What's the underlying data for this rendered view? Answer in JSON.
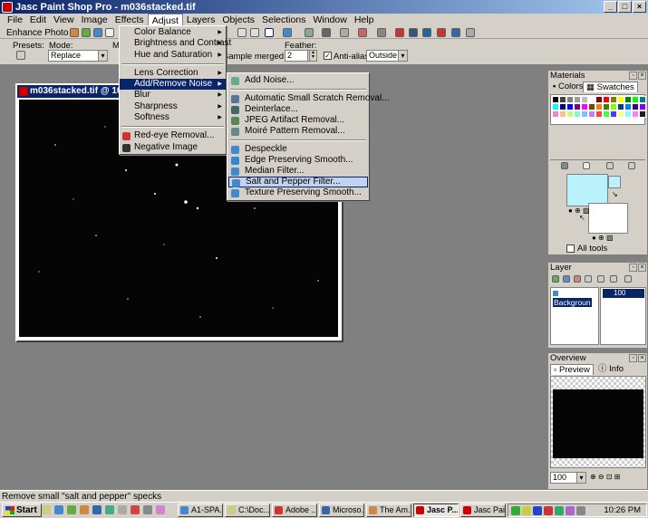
{
  "app": {
    "title": "Jasc Paint Shop Pro - m036stacked.tif"
  },
  "window_buttons": [
    "_",
    "□",
    "×"
  ],
  "menubar": [
    "File",
    "Edit",
    "View",
    "Image",
    "Effects",
    "Adjust",
    "Layers",
    "Objects",
    "Selections",
    "Window",
    "Help"
  ],
  "toolbar": {
    "enhance_photo": "Enhance Photo"
  },
  "options": {
    "presets_label": "Presets:",
    "mode_label": "Mode:",
    "mode_value": "Replace",
    "sample_label": "Sample merged",
    "feather_label": "Feather:",
    "feather_value": "2",
    "antialias_label": "Anti-alias",
    "antialias_value": "Outside",
    "match_partial": "M"
  },
  "image_window": {
    "title": "m036stacked.tif @ 100%"
  },
  "adjust_menu": {
    "items": [
      {
        "label": "Color Balance",
        "sub": true
      },
      {
        "label": "Brightness and Contrast",
        "sub": true
      },
      {
        "label": "Hue and Saturation",
        "sub": true
      },
      {
        "sep": true
      },
      {
        "label": "Lens Correction",
        "sub": true
      },
      {
        "label": "Add/Remove Noise",
        "sub": true,
        "hl": true
      },
      {
        "label": "Blur",
        "sub": true
      },
      {
        "label": "Sharpness",
        "sub": true
      },
      {
        "label": "Softness",
        "sub": true
      },
      {
        "sep": true
      },
      {
        "label": "Red-eye Removal...",
        "icon": "red-eye-icon"
      },
      {
        "label": "Negative Image",
        "icon": "negative-icon"
      }
    ]
  },
  "noise_menu": {
    "items": [
      {
        "label": "Add Noise...",
        "icon": "add-noise-icon"
      },
      {
        "sep": true
      },
      {
        "label": "Automatic Small Scratch Removal...",
        "icon": "scratch-icon"
      },
      {
        "label": "Deinterlace...",
        "icon": "deinterlace-icon"
      },
      {
        "label": "JPEG Artifact Removal...",
        "icon": "jpeg-icon"
      },
      {
        "label": "Moiré Pattern Removal...",
        "icon": "moire-icon"
      },
      {
        "sep": true
      },
      {
        "label": "Despeckle",
        "icon": "despeckle-icon"
      },
      {
        "label": "Edge Preserving Smooth...",
        "icon": "edge-smooth-icon"
      },
      {
        "label": "Median Filter...",
        "icon": "median-icon"
      },
      {
        "label": "Salt and Pepper Filter...",
        "icon": "salt-pepper-icon",
        "hl": true
      },
      {
        "label": "Texture Preserving Smooth...",
        "icon": "texture-smooth-icon"
      }
    ]
  },
  "materials": {
    "title": "Materials",
    "tab_colors": "Colors",
    "tab_swatches": "Swatches",
    "all_tools": "All tools"
  },
  "layers": {
    "title": "Layer",
    "layer_name": "Backgroun",
    "opacity_val": "100"
  },
  "overview": {
    "title": "Overview",
    "tab_preview": "Preview",
    "tab_info": "Info",
    "zoom": "100"
  },
  "status": "Remove small \"salt and pepper\" specks",
  "taskbar": {
    "start": "Start",
    "buttons": [
      {
        "label": "A1-SPA..."
      },
      {
        "label": "C:\\Doc..."
      },
      {
        "label": "Adobe ..."
      },
      {
        "label": "Microso..."
      },
      {
        "label": "The Am..."
      },
      {
        "label": "Jasc P...",
        "active": true
      },
      {
        "label": "Jasc Pai..."
      }
    ],
    "clock": "10:26 PM"
  },
  "colors": {
    "title_bar": "#0a246a",
    "chrome": "#d4d0c8",
    "workspace": "#808080",
    "fg_swatch": "#b9f2fc"
  }
}
